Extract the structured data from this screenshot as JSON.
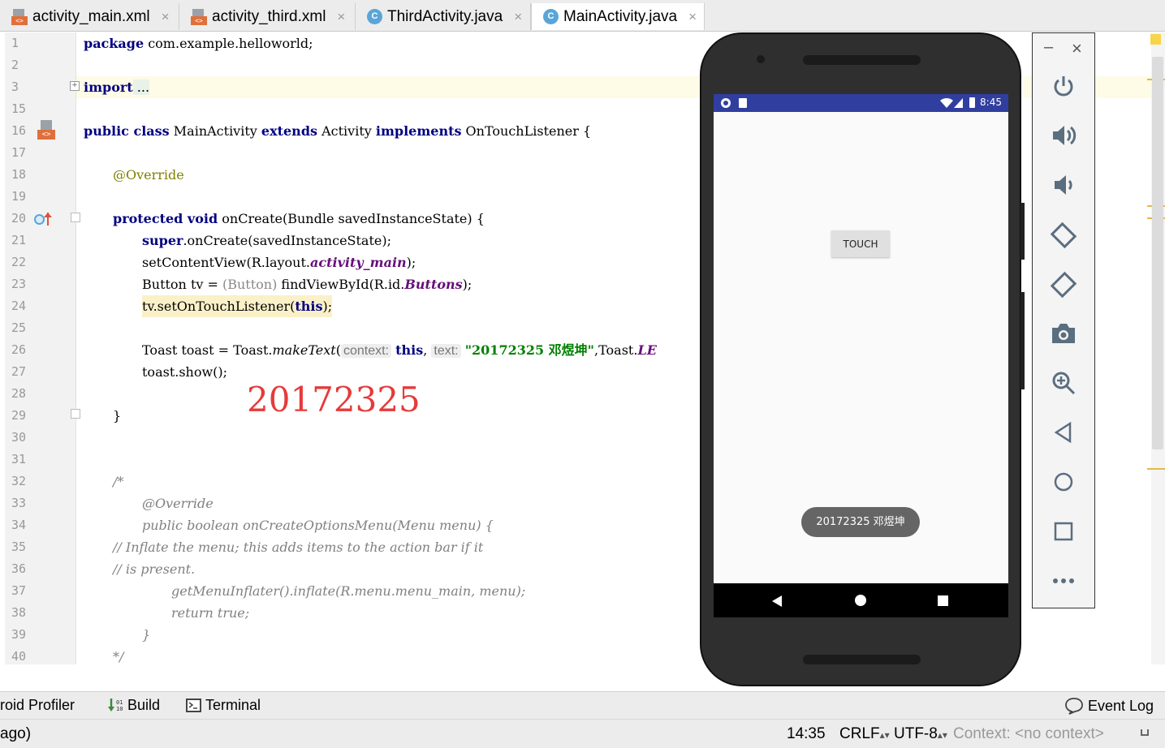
{
  "tabs": [
    {
      "label": "activity_main.xml",
      "icon": "xml-file-icon",
      "active": false
    },
    {
      "label": "activity_third.xml",
      "icon": "xml-file-icon",
      "active": false
    },
    {
      "label": "ThirdActivity.java",
      "icon": "java-class-icon",
      "active": false
    },
    {
      "label": "MainActivity.java",
      "icon": "java-class-icon",
      "active": true
    }
  ],
  "tab_close_glyph": "×",
  "class_icon_letter": "C",
  "xml_badge_text": "<>",
  "line_numbers": [
    "1",
    "2",
    "3",
    "15",
    "16",
    "17",
    "18",
    "19",
    "20",
    "21",
    "22",
    "23",
    "24",
    "25",
    "26",
    "27",
    "28",
    "29",
    "30",
    "31",
    "32",
    "33",
    "34",
    "35",
    "36",
    "37",
    "38",
    "39",
    "40"
  ],
  "code": {
    "l1_kw": "package",
    "l1_rest": " com.example.helloworld;",
    "l3_kw": "import",
    "l3_rest": " ...",
    "l16_kw1": "public class",
    "l16_name": " MainActivity ",
    "l16_kw2": "extends",
    "l16_base": " Activity ",
    "l16_kw3": "implements",
    "l16_iface": " OnTouchListener {",
    "l18": "@Override",
    "l20_kw": "protected void",
    "l20_rest": " onCreate(Bundle savedInstanceState) {",
    "l21_kw": "super",
    "l21_rest": ".onCreate(savedInstanceState);",
    "l22_a": "setContentView(R.layout.",
    "l22_field": "activity_main",
    "l22_b": ");",
    "l23_a": "Button tv = ",
    "l23_cast": "(Button)",
    "l23_b": " findViewById(R.id.",
    "l23_field": "Buttons",
    "l23_c": ");",
    "l24_a": "tv.setOnTouchListener(",
    "l24_kw": "this",
    "l24_b": ");",
    "l26_a": "Toast toast = Toast.",
    "l26_method": "makeText",
    "l26_b": "(",
    "l26_hint1": "context:",
    "l26_kw": "this",
    "l26_c": ", ",
    "l26_hint2": "text:",
    "l26_str": "\"20172325 邓煜坤\"",
    "l26_d": ",Toast.",
    "l26_field": "LE",
    "l27": "toast.show();",
    "l29": "}",
    "l32": "/*",
    "l33": "@Override",
    "l34": "public boolean onCreateOptionsMenu(Menu menu) {",
    "l35": "// Inflate the menu; this adds items to the action bar if it",
    "l36": "// is present.",
    "l37": "getMenuInflater().inflate(R.menu.menu_main, menu);",
    "l38": "return true;",
    "l39": "}",
    "l40": "*/"
  },
  "overlay_text": "20172325",
  "phone": {
    "time": "8:45",
    "touch_button": "TOUCH",
    "toast": "20172325 邓煜坤",
    "statusbar_color": "#303f9f"
  },
  "emulator_panel": {
    "minimize": "–",
    "close": "×",
    "buttons": [
      "power-icon",
      "volume-up-icon",
      "volume-down-icon",
      "rotate-left-icon",
      "rotate-right-icon",
      "camera-icon",
      "zoom-icon",
      "back-icon",
      "home-icon",
      "overview-icon",
      "more-icon"
    ]
  },
  "bottom_tools": {
    "profiler": "roid Profiler",
    "build": "Build",
    "terminal": "Terminal",
    "event_log": "Event Log"
  },
  "status": {
    "left": "ago)",
    "position": "14:35",
    "line_sep": "CRLF",
    "encoding": "UTF-8",
    "context": "Context: <no context>"
  }
}
